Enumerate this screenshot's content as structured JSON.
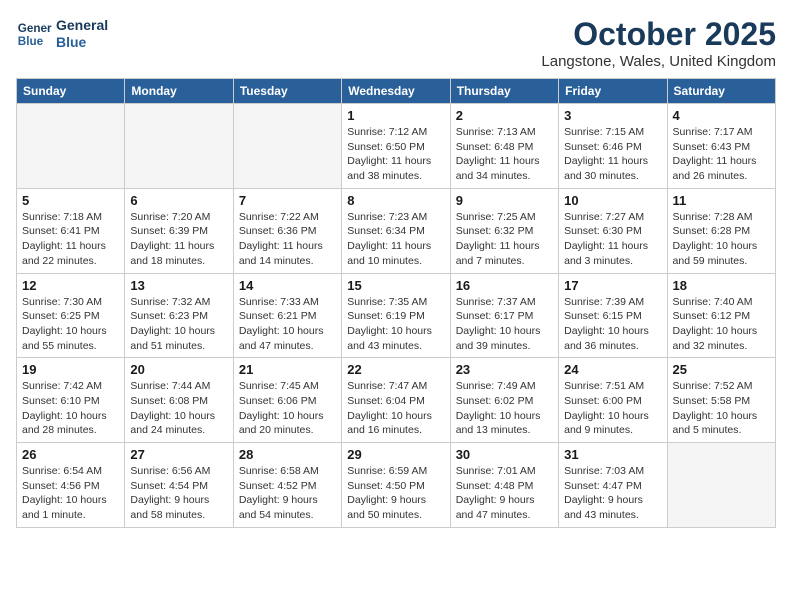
{
  "logo": {
    "line1": "General",
    "line2": "Blue"
  },
  "title": "October 2025",
  "subtitle": "Langstone, Wales, United Kingdom",
  "days_of_week": [
    "Sunday",
    "Monday",
    "Tuesday",
    "Wednesday",
    "Thursday",
    "Friday",
    "Saturday"
  ],
  "weeks": [
    [
      {
        "day": "",
        "info": ""
      },
      {
        "day": "",
        "info": ""
      },
      {
        "day": "",
        "info": ""
      },
      {
        "day": "1",
        "info": "Sunrise: 7:12 AM\nSunset: 6:50 PM\nDaylight: 11 hours\nand 38 minutes."
      },
      {
        "day": "2",
        "info": "Sunrise: 7:13 AM\nSunset: 6:48 PM\nDaylight: 11 hours\nand 34 minutes."
      },
      {
        "day": "3",
        "info": "Sunrise: 7:15 AM\nSunset: 6:46 PM\nDaylight: 11 hours\nand 30 minutes."
      },
      {
        "day": "4",
        "info": "Sunrise: 7:17 AM\nSunset: 6:43 PM\nDaylight: 11 hours\nand 26 minutes."
      }
    ],
    [
      {
        "day": "5",
        "info": "Sunrise: 7:18 AM\nSunset: 6:41 PM\nDaylight: 11 hours\nand 22 minutes."
      },
      {
        "day": "6",
        "info": "Sunrise: 7:20 AM\nSunset: 6:39 PM\nDaylight: 11 hours\nand 18 minutes."
      },
      {
        "day": "7",
        "info": "Sunrise: 7:22 AM\nSunset: 6:36 PM\nDaylight: 11 hours\nand 14 minutes."
      },
      {
        "day": "8",
        "info": "Sunrise: 7:23 AM\nSunset: 6:34 PM\nDaylight: 11 hours\nand 10 minutes."
      },
      {
        "day": "9",
        "info": "Sunrise: 7:25 AM\nSunset: 6:32 PM\nDaylight: 11 hours\nand 7 minutes."
      },
      {
        "day": "10",
        "info": "Sunrise: 7:27 AM\nSunset: 6:30 PM\nDaylight: 11 hours\nand 3 minutes."
      },
      {
        "day": "11",
        "info": "Sunrise: 7:28 AM\nSunset: 6:28 PM\nDaylight: 10 hours\nand 59 minutes."
      }
    ],
    [
      {
        "day": "12",
        "info": "Sunrise: 7:30 AM\nSunset: 6:25 PM\nDaylight: 10 hours\nand 55 minutes."
      },
      {
        "day": "13",
        "info": "Sunrise: 7:32 AM\nSunset: 6:23 PM\nDaylight: 10 hours\nand 51 minutes."
      },
      {
        "day": "14",
        "info": "Sunrise: 7:33 AM\nSunset: 6:21 PM\nDaylight: 10 hours\nand 47 minutes."
      },
      {
        "day": "15",
        "info": "Sunrise: 7:35 AM\nSunset: 6:19 PM\nDaylight: 10 hours\nand 43 minutes."
      },
      {
        "day": "16",
        "info": "Sunrise: 7:37 AM\nSunset: 6:17 PM\nDaylight: 10 hours\nand 39 minutes."
      },
      {
        "day": "17",
        "info": "Sunrise: 7:39 AM\nSunset: 6:15 PM\nDaylight: 10 hours\nand 36 minutes."
      },
      {
        "day": "18",
        "info": "Sunrise: 7:40 AM\nSunset: 6:12 PM\nDaylight: 10 hours\nand 32 minutes."
      }
    ],
    [
      {
        "day": "19",
        "info": "Sunrise: 7:42 AM\nSunset: 6:10 PM\nDaylight: 10 hours\nand 28 minutes."
      },
      {
        "day": "20",
        "info": "Sunrise: 7:44 AM\nSunset: 6:08 PM\nDaylight: 10 hours\nand 24 minutes."
      },
      {
        "day": "21",
        "info": "Sunrise: 7:45 AM\nSunset: 6:06 PM\nDaylight: 10 hours\nand 20 minutes."
      },
      {
        "day": "22",
        "info": "Sunrise: 7:47 AM\nSunset: 6:04 PM\nDaylight: 10 hours\nand 16 minutes."
      },
      {
        "day": "23",
        "info": "Sunrise: 7:49 AM\nSunset: 6:02 PM\nDaylight: 10 hours\nand 13 minutes."
      },
      {
        "day": "24",
        "info": "Sunrise: 7:51 AM\nSunset: 6:00 PM\nDaylight: 10 hours\nand 9 minutes."
      },
      {
        "day": "25",
        "info": "Sunrise: 7:52 AM\nSunset: 5:58 PM\nDaylight: 10 hours\nand 5 minutes."
      }
    ],
    [
      {
        "day": "26",
        "info": "Sunrise: 6:54 AM\nSunset: 4:56 PM\nDaylight: 10 hours\nand 1 minute."
      },
      {
        "day": "27",
        "info": "Sunrise: 6:56 AM\nSunset: 4:54 PM\nDaylight: 9 hours\nand 58 minutes."
      },
      {
        "day": "28",
        "info": "Sunrise: 6:58 AM\nSunset: 4:52 PM\nDaylight: 9 hours\nand 54 minutes."
      },
      {
        "day": "29",
        "info": "Sunrise: 6:59 AM\nSunset: 4:50 PM\nDaylight: 9 hours\nand 50 minutes."
      },
      {
        "day": "30",
        "info": "Sunrise: 7:01 AM\nSunset: 4:48 PM\nDaylight: 9 hours\nand 47 minutes."
      },
      {
        "day": "31",
        "info": "Sunrise: 7:03 AM\nSunset: 4:47 PM\nDaylight: 9 hours\nand 43 minutes."
      },
      {
        "day": "",
        "info": ""
      }
    ]
  ]
}
